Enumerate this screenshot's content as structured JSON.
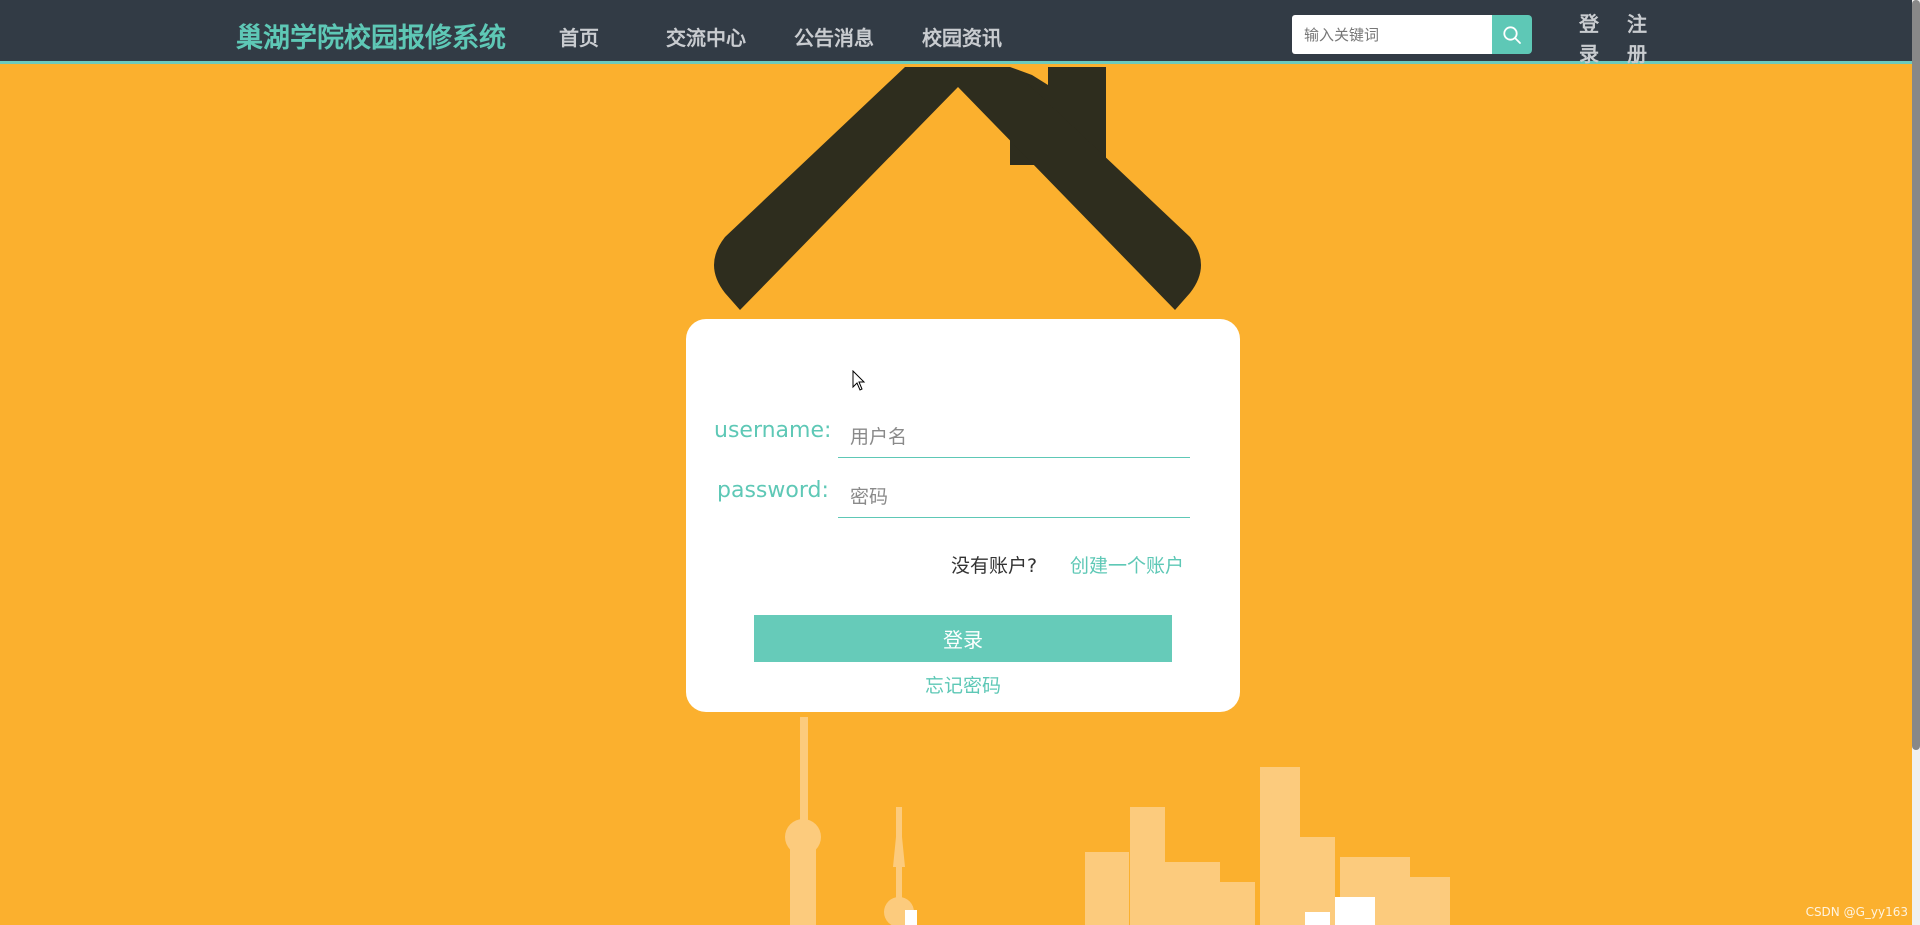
{
  "header": {
    "brand": "巢湖学院校园报修系统",
    "nav": [
      "首页",
      "交流中心",
      "公告消息",
      "校园资讯"
    ],
    "search_placeholder": "输入关键词",
    "search_icon": "search-icon",
    "login": [
      "登",
      "录"
    ],
    "register": [
      "注",
      "册"
    ]
  },
  "login_form": {
    "username_label": "username:",
    "username_placeholder": "用户名",
    "password_label": "password:",
    "password_placeholder": "密码",
    "no_account_text": "没有账户?",
    "create_account_link": "创建一个账户",
    "submit_label": "登录",
    "forgot_password_link": "忘记密码"
  },
  "watermark": "CSDN @G_yy163",
  "colors": {
    "background": "#fbb02e",
    "navbar": "#323b45",
    "accent": "#5ec8b6",
    "button": "#66cbb9",
    "house_roof": "#2e2d1e",
    "skyline": "#fccb7d"
  }
}
